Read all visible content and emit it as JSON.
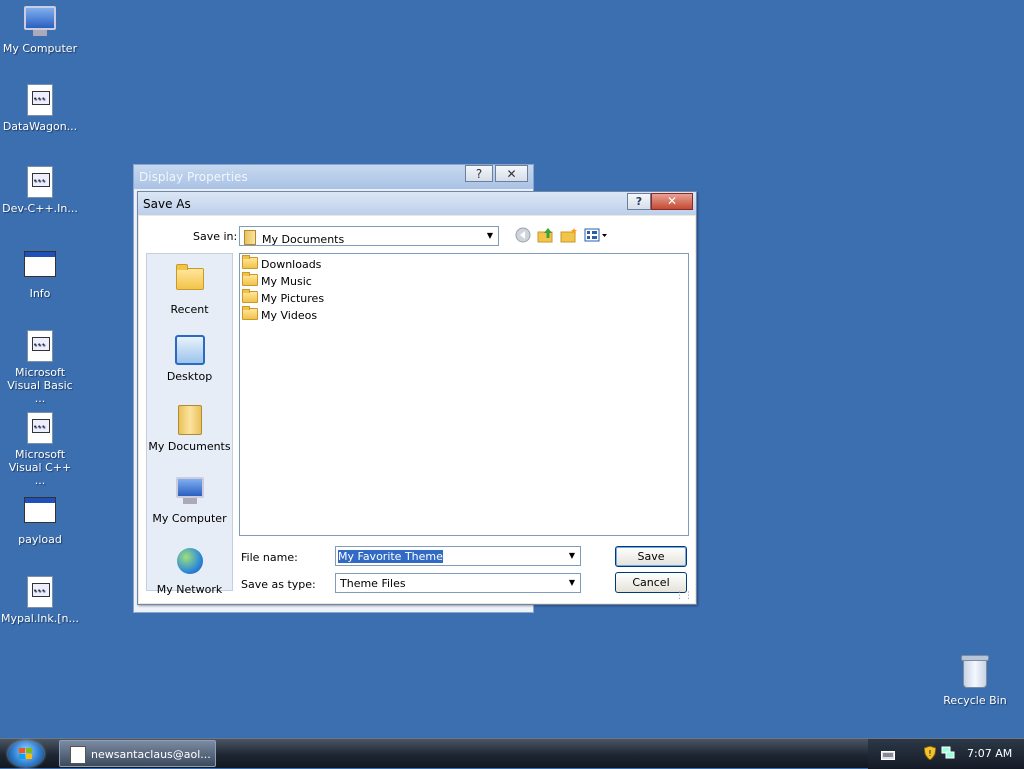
{
  "desktop": {
    "icons": [
      {
        "label": "My Computer",
        "icon": "my-computer-icon"
      },
      {
        "label": "DataWagon...",
        "icon": "application-file-icon"
      },
      {
        "label": "Dev-C++.In...",
        "icon": "application-file-icon"
      },
      {
        "label": "Info",
        "icon": "window-file-icon"
      },
      {
        "label": "Microsoft Visual Basic ...",
        "icon": "application-file-icon"
      },
      {
        "label": "Microsoft Visual C++ ...",
        "icon": "application-file-icon"
      },
      {
        "label": "payload",
        "icon": "window-file-icon"
      },
      {
        "label": "Mypal.lnk.[n...",
        "icon": "application-file-icon"
      },
      {
        "label": "Recycle Bin",
        "icon": "recycle-bin-icon"
      }
    ]
  },
  "display_properties": {
    "title": "Display Properties",
    "help_glyph": "?",
    "close_glyph": "✕"
  },
  "save_as": {
    "title": "Save As",
    "help_glyph": "?",
    "close_glyph": "✕",
    "save_in_label": "Save in:",
    "save_in_value": "My Documents",
    "toolbar_icons": [
      "back-icon",
      "up-folder-icon",
      "new-folder-icon",
      "views-menu-icon"
    ],
    "places": [
      {
        "label": "Recent",
        "icon": "recent-folder-icon"
      },
      {
        "label": "Desktop",
        "icon": "desktop-icon"
      },
      {
        "label": "My Documents",
        "icon": "my-documents-icon"
      },
      {
        "label": "My Computer",
        "icon": "my-computer-icon"
      },
      {
        "label": "My Network",
        "icon": "my-network-icon"
      }
    ],
    "files": [
      {
        "name": "Downloads",
        "icon": "folder-icon"
      },
      {
        "name": "My Music",
        "icon": "folder-icon"
      },
      {
        "name": "My Pictures",
        "icon": "folder-icon"
      },
      {
        "name": "My Videos",
        "icon": "folder-icon"
      }
    ],
    "file_name_label": "File name:",
    "file_name_value": "My Favorite Theme",
    "save_type_label": "Save as type:",
    "save_type_value": "Theme Files",
    "save_button": "Save",
    "cancel_button": "Cancel"
  },
  "taskbar": {
    "task_label": "newsantaclaus@aol...",
    "clock": "7:07 AM",
    "tray_icons": [
      "keyboard-icon",
      "security-shield-icon",
      "network-icon"
    ]
  }
}
